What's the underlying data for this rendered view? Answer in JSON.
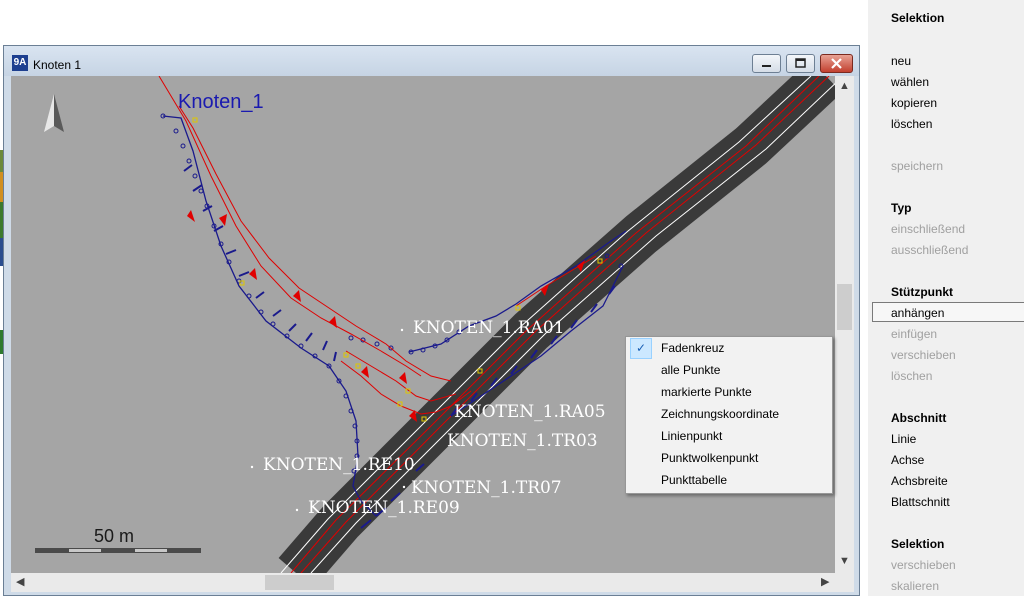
{
  "window": {
    "title": "Knoten 1",
    "app_icon_glyph": "9A",
    "minimize_icon": "minimize-icon",
    "maximize_icon": "maximize-icon",
    "close_icon": "close-icon"
  },
  "drawing": {
    "node_title": "Knoten_1",
    "north_icon": "north-arrow-icon",
    "labels": [
      {
        "text": "KNOTEN_1.RA01"
      },
      {
        "text": "KNOTEN_1.RA05"
      },
      {
        "text": "KNOTEN_1.TR03"
      },
      {
        "text": "KNOTEN_1.RE10"
      },
      {
        "text": "KNOTEN_1.TR07"
      },
      {
        "text": "KNOTEN_1.RE09"
      }
    ],
    "scale_label": "50 m",
    "colors": {
      "background": "#a5a5a5",
      "road": "#3a3a3a",
      "red_line": "#e00000",
      "blue_line": "#1a1a8c",
      "node_title": "#1a1ab0"
    }
  },
  "context_menu": {
    "items": [
      {
        "label": "Fadenkreuz",
        "checked": true
      },
      {
        "label": "alle Punkte"
      },
      {
        "label": "markierte Punkte"
      },
      {
        "label": "Zeichnungskoordinate"
      },
      {
        "label": "Linienpunkt"
      },
      {
        "label": "Punktwolkenpunkt"
      },
      {
        "label": "Punkttabelle"
      }
    ],
    "check_glyph": "✓"
  },
  "side_panel": {
    "sections": [
      {
        "heading": "Selektion",
        "items": [
          {
            "label": "neu",
            "enabled": true
          },
          {
            "label": "wählen",
            "enabled": true
          },
          {
            "label": "kopieren",
            "enabled": true
          },
          {
            "label": "löschen",
            "enabled": true
          },
          {
            "label": "speichern",
            "enabled": false
          }
        ]
      },
      {
        "heading": "Typ",
        "items": [
          {
            "label": "einschließend",
            "enabled": false
          },
          {
            "label": "ausschließend",
            "enabled": false
          }
        ]
      },
      {
        "heading": "Stützpunkt",
        "items": [
          {
            "label": "anhängen",
            "enabled": true,
            "selected": true
          },
          {
            "label": "einfügen",
            "enabled": false
          },
          {
            "label": "verschieben",
            "enabled": false
          },
          {
            "label": "löschen",
            "enabled": false
          }
        ]
      },
      {
        "heading": "Abschnitt",
        "items": [
          {
            "label": "Linie",
            "enabled": true
          },
          {
            "label": "Achse",
            "enabled": true
          },
          {
            "label": "Achsbreite",
            "enabled": true
          },
          {
            "label": "Blattschnitt",
            "enabled": true
          }
        ]
      },
      {
        "heading": "Selektion",
        "items": [
          {
            "label": "verschieben",
            "enabled": false
          },
          {
            "label": "skalieren",
            "enabled": false
          }
        ]
      }
    ]
  },
  "scrollbars": {
    "up_arrow": "▲",
    "down_arrow": "▼",
    "left_arrow": "◀",
    "right_arrow": "▶"
  }
}
